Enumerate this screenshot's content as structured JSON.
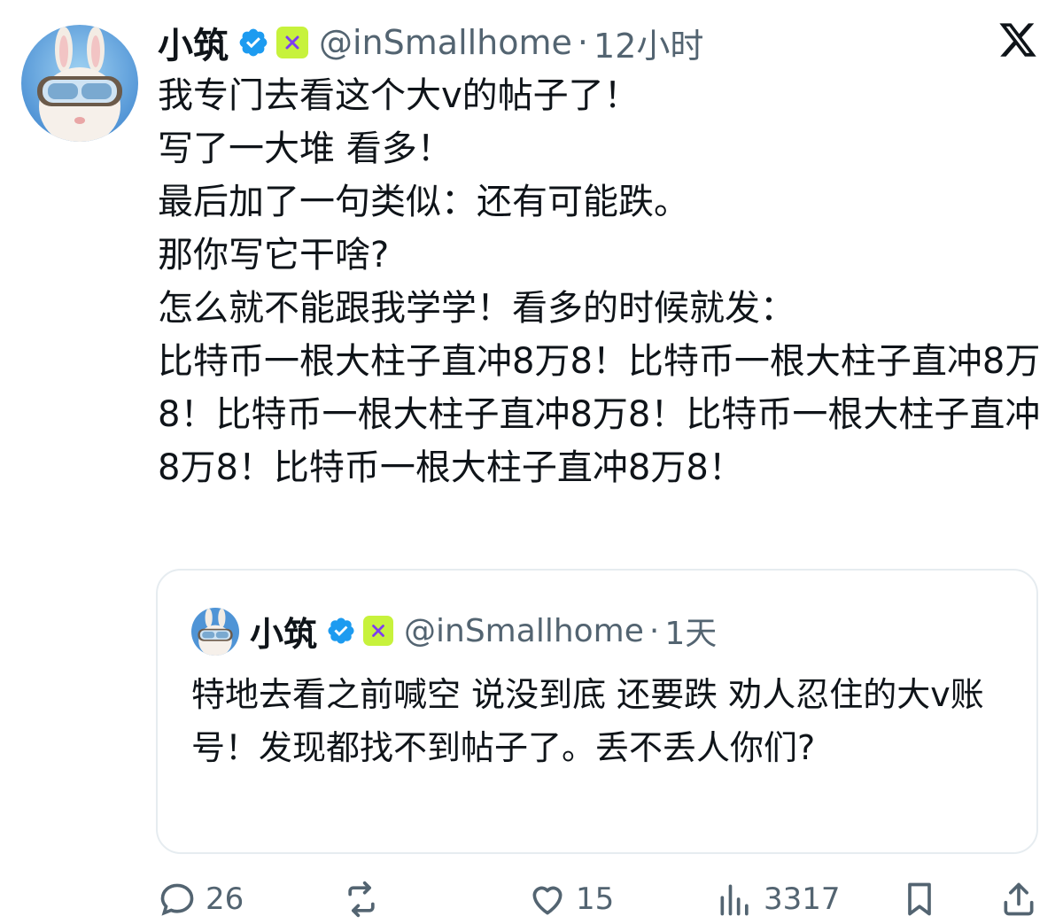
{
  "post": {
    "author_name": "小筑",
    "handle": "@inSmallhome",
    "separator": "·",
    "time": "12小时",
    "body_lines": [
      "我专门去看这个大v的帖子了！",
      "写了一大堆 看多！",
      "最后加了一句类似：还有可能跌。",
      "那你写它干啥?",
      "怎么就不能跟我学学！看多的时候就发：",
      "比特币一根大柱子直冲8万8！比特币一根大柱子直冲8万8！比特币一根大柱子直冲8万8！比特币一根大柱子直冲8万8！比特币一根大柱子直冲8万8！"
    ]
  },
  "quoted": {
    "author_name": "小筑",
    "handle": "@inSmallhome",
    "separator": "·",
    "time": "1天",
    "text": "特地去看之前喊空 说没到底 还要跌 劝人忍住的大v账号！发现都找不到帖子了。丢不丢人你们?"
  },
  "actions": {
    "replies": "26",
    "reposts": "",
    "likes": "15",
    "views": "3317"
  },
  "icons": {
    "avatar": "bunny-with-goggles-avatar",
    "verified": "verified-badge-icon",
    "affiliation": "affiliate-badge-icon",
    "logo": "x-logo-icon"
  },
  "colors": {
    "text": "#0f1419",
    "muted": "#536471",
    "verified": "#1d9bf0",
    "affiliate_bg": "#c7f23c",
    "affiliate_fg": "#7d3cf2",
    "border": "#e6ecf0"
  }
}
